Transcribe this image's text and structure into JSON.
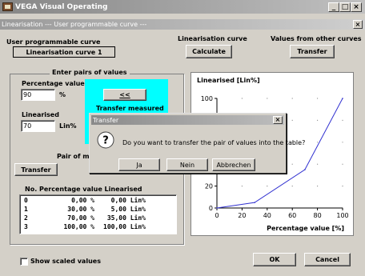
{
  "window": {
    "title": "VEGA Visual Operating"
  },
  "subwindow": {
    "title": "Linearisation --- User programmable curve ---"
  },
  "curve": {
    "label": "User programmable curve",
    "value": "Linearisation curve 1"
  },
  "linearisation": {
    "label": "Linearisation curve",
    "calculate_label": "Calculate"
  },
  "other_curves": {
    "label": "Values from other curves",
    "transfer_label": "Transfer"
  },
  "pairs": {
    "title": "Enter pairs of values",
    "percentage_label": "Percentage value",
    "percentage_value": "90",
    "percentage_unit": "%",
    "linearised_label": "Linearised",
    "linearised_value": "70",
    "linearised_unit": "Lin%",
    "back_label": "<<",
    "transfer_measured_label": "Transfer measured",
    "pair_label": "Pair of me",
    "transfer_label": "Transfer"
  },
  "table": {
    "header": "No. Percentage value  Linearised",
    "rows": [
      {
        "no": "0",
        "pct": "0,00 %",
        "lin": "0,00 Lin%"
      },
      {
        "no": "1",
        "pct": "30,00 %",
        "lin": "5,00 Lin%"
      },
      {
        "no": "2",
        "pct": "70,00 %",
        "lin": "35,00 Lin%"
      },
      {
        "no": "3",
        "pct": "100,00 %",
        "lin": "100,00 Lin%"
      }
    ]
  },
  "show_scaled": {
    "label": "Show scaled values",
    "checked": false
  },
  "buttons": {
    "ok": "OK",
    "cancel": "Cancel"
  },
  "dialog": {
    "title": "Transfer",
    "message": "Do you want to transfer the pair of values into the table?",
    "yes": "Ja",
    "no": "Nein",
    "cancel": "Abbrechen"
  },
  "chart_data": {
    "type": "line",
    "title": "Linearised [Lin%]",
    "xlabel": "Percentage value [%]",
    "ylabel": "",
    "xlim": [
      0,
      100
    ],
    "ylim": [
      0,
      100
    ],
    "x_ticks": [
      "0",
      "20",
      "40",
      "60",
      "80",
      "100"
    ],
    "y_ticks": [
      "0",
      "20",
      "100"
    ],
    "series": [
      {
        "x": [
          0,
          30,
          70,
          100
        ],
        "y": [
          0,
          5,
          35,
          100
        ],
        "color": "#3030d0"
      }
    ],
    "grid": "dotted"
  }
}
